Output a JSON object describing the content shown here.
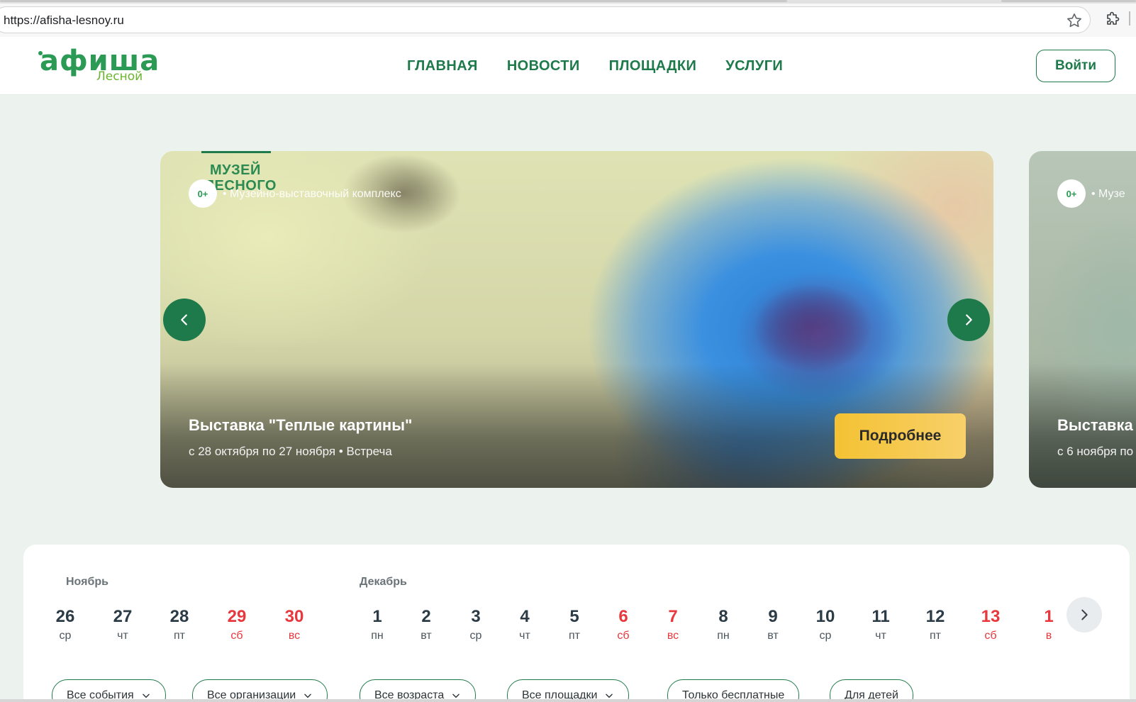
{
  "browser": {
    "url": "https://afisha-lesnoy.ru"
  },
  "header": {
    "logo_main": "афиша",
    "logo_sub": "Лесной",
    "nav": [
      "ГЛАВНАЯ",
      "НОВОСТИ",
      "ПЛОЩАДКИ",
      "УСЛУГИ"
    ],
    "login": "Войти"
  },
  "slider": {
    "current": {
      "museum_logo_line1": "МУЗЕЙ",
      "museum_logo_line2": "ЛЕСНОГО",
      "age": "0+",
      "organization": "• Музейно-выставочный комплекс",
      "title": "Выставка \"Теплые картины\"",
      "subtitle": "с 28 октября по 27 ноября • Встреча",
      "more_button": "Подробнее"
    },
    "next": {
      "age": "0+",
      "organization": "• Музе",
      "title": "Выставка",
      "subtitle": "с 6 ноября по"
    },
    "accent_color": "#1f7a4b",
    "button_color": "#f5c542"
  },
  "calendar": {
    "months": [
      "Ноябрь",
      "Декабрь"
    ],
    "days": [
      {
        "num": "26",
        "wd": "ср",
        "weekend": false
      },
      {
        "num": "27",
        "wd": "чт",
        "weekend": false
      },
      {
        "num": "28",
        "wd": "пт",
        "weekend": false
      },
      {
        "num": "29",
        "wd": "сб",
        "weekend": true
      },
      {
        "num": "30",
        "wd": "вс",
        "weekend": true
      },
      {
        "num": "1",
        "wd": "пн",
        "weekend": false
      },
      {
        "num": "2",
        "wd": "вт",
        "weekend": false
      },
      {
        "num": "3",
        "wd": "ср",
        "weekend": false
      },
      {
        "num": "4",
        "wd": "чт",
        "weekend": false
      },
      {
        "num": "5",
        "wd": "пт",
        "weekend": false
      },
      {
        "num": "6",
        "wd": "сб",
        "weekend": true
      },
      {
        "num": "7",
        "wd": "вс",
        "weekend": true
      },
      {
        "num": "8",
        "wd": "пн",
        "weekend": false
      },
      {
        "num": "9",
        "wd": "вт",
        "weekend": false
      },
      {
        "num": "10",
        "wd": "ср",
        "weekend": false
      },
      {
        "num": "11",
        "wd": "чт",
        "weekend": false
      },
      {
        "num": "12",
        "wd": "пт",
        "weekend": false
      },
      {
        "num": "13",
        "wd": "сб",
        "weekend": true
      },
      {
        "num": "1",
        "wd": "в",
        "weekend": true
      }
    ],
    "weekend_color": "#e8383d"
  },
  "filters": [
    "Все события",
    "Все организации",
    "Все возраста",
    "Все площадки",
    "Только бесплатные",
    "Для детей"
  ]
}
